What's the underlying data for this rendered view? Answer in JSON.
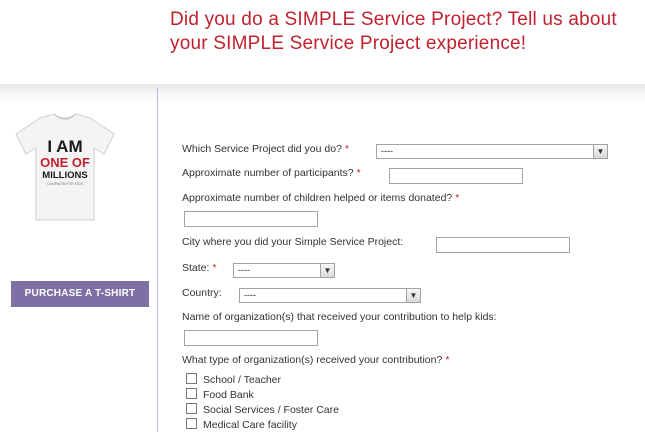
{
  "header": {
    "title": "Did you do a SIMPLE Service Project?  Tell us about your SIMPLE Service Project experience!"
  },
  "sidebar": {
    "shirt_line1": "I AM",
    "shirt_line2": "ONE OF",
    "shirt_line3": "MILLIONS",
    "shirt_tagline": "CAMPAIGN FOR KIDS",
    "purchase_label": "PURCHASE A T-SHIRT"
  },
  "form": {
    "service_project": {
      "label": "Which Service Project did you do?",
      "required": "*",
      "value": "----"
    },
    "participants": {
      "label": "Approximate number of participants?",
      "required": "*",
      "value": ""
    },
    "children_helped": {
      "label": "Approximate number of children helped or items donated?",
      "required": "*",
      "value": ""
    },
    "city": {
      "label": "City where you did your Simple Service Project:",
      "value": ""
    },
    "state": {
      "label": "State:",
      "required": "*",
      "value": "----"
    },
    "country": {
      "label": "Country:",
      "value": "----"
    },
    "organization_name": {
      "label": "Name of organization(s) that received your contribution to help kids:",
      "value": ""
    },
    "org_type": {
      "label": "What type of organization(s) received your contribution?",
      "required": "*",
      "options": [
        "School / Teacher",
        "Food Bank",
        "Social Services / Foster Care",
        "Medical Care facility"
      ]
    }
  },
  "colors": {
    "accent_red": "#c0212f",
    "button_purple": "#7d70a5",
    "divider": "#b9b6d6"
  },
  "icons": {
    "dropdown": "chevron-down-icon",
    "shirt": "tshirt-image"
  }
}
